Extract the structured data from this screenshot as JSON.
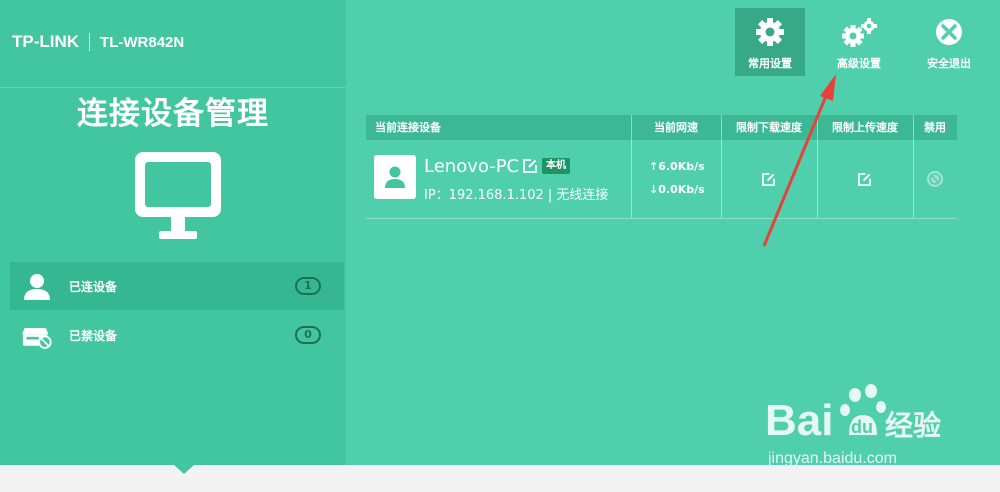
{
  "brand": {
    "logo": "TP-LINK",
    "model": "TL-WR842N"
  },
  "page_title": "连接设备管理",
  "sidebar": {
    "items": [
      {
        "label": "已连设备",
        "count": "1",
        "icon": "user-icon",
        "active": true
      },
      {
        "label": "已禁设备",
        "count": "0",
        "icon": "blocked-device-icon",
        "active": false
      }
    ]
  },
  "toolbar": {
    "buttons": [
      {
        "label": "常用设置",
        "icon": "gear-icon",
        "active": true
      },
      {
        "label": "高级设置",
        "icon": "gears-icon",
        "active": false
      },
      {
        "label": "安全退出",
        "icon": "close-circle-icon",
        "active": false
      }
    ]
  },
  "table": {
    "headers": [
      "当前连接设备",
      "当前网速",
      "限制下载速度",
      "限制上传速度",
      "禁用"
    ],
    "rows": [
      {
        "name": "Lenovo-PC",
        "badge": "本机",
        "ip": "IP：192.168.1.102 | 无线连接",
        "upload": "↑6.0Kb/s",
        "download": "↓0.0Kb/s"
      }
    ]
  },
  "watermark": {
    "brand": "Bai经验",
    "url": "jingyan.baidu.com"
  },
  "colors": {
    "background": "#4fcfab",
    "sidebar": "#41c69f",
    "active": "#37a987",
    "arrow": "#e8413a"
  }
}
